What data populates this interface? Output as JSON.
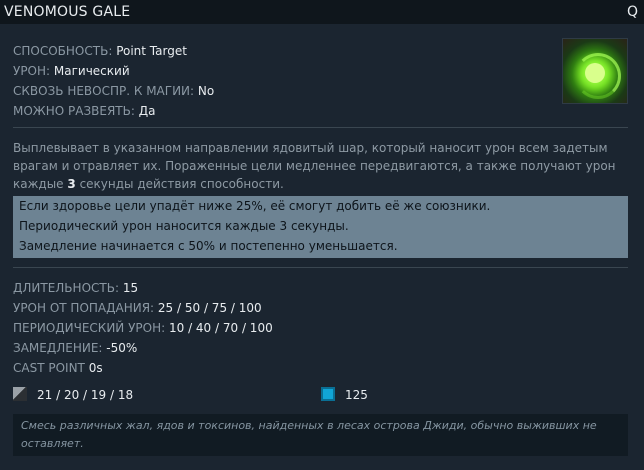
{
  "ability": {
    "name": "VENOMOUS GALE",
    "hotkey": "Q"
  },
  "properties": [
    {
      "label": "СПОСОБНОСТЬ:",
      "value": "Point Target"
    },
    {
      "label": "УРОН:",
      "value": "Магический"
    },
    {
      "label": "СКВОЗЬ НЕВОСПР. К МАГИИ:",
      "value": "No"
    },
    {
      "label": "МОЖНО РАЗВЕЯТЬ:",
      "value": "Да"
    }
  ],
  "description": {
    "text": "Выплевывает в указанном направлении ядовитый шар, который наносит урон всем задетым врагам и отравляет их. Пораженные цели медленнее передвигаются, а также получают урон каждые ",
    "number": "3",
    "suffix": " секунды действия способности."
  },
  "notes": [
    "Если здоровье цели упадёт ниже 25%, её смогут добить её же союзники.",
    "Периодический урон наносится каждые 3 секунды.",
    "Замедление начинается с 50% и постепенно уменьшается."
  ],
  "stats": [
    {
      "label": "ДЛИТЕЛЬНОСТЬ:",
      "value": "15"
    },
    {
      "label": "УРОН ОТ ПОПАДАНИЯ:",
      "value": "25 / 50 / 75 / 100"
    },
    {
      "label": "ПЕРИОДИЧЕСКИЙ УРОН:",
      "value": "10 / 40 / 70 / 100"
    },
    {
      "label": "ЗАМЕДЛЕНИЕ:",
      "value": "-50%"
    },
    {
      "label": "CAST POINT",
      "value": "0s"
    }
  ],
  "costs": {
    "cooldown": "21 / 20 / 19 / 18",
    "mana": "125"
  },
  "lore": "Смесь различных жал, ядов и токсинов, найденных в лесах острова Джиди, обычно выживших не оставляет.",
  "colors": {
    "mana": "#11a5d6",
    "notes_bg": "#6d8393",
    "panel_bg": "#1b2530"
  },
  "icons": {
    "ability": "venomous-gale-icon",
    "cooldown": "cooldown-icon",
    "mana": "mana-icon"
  }
}
